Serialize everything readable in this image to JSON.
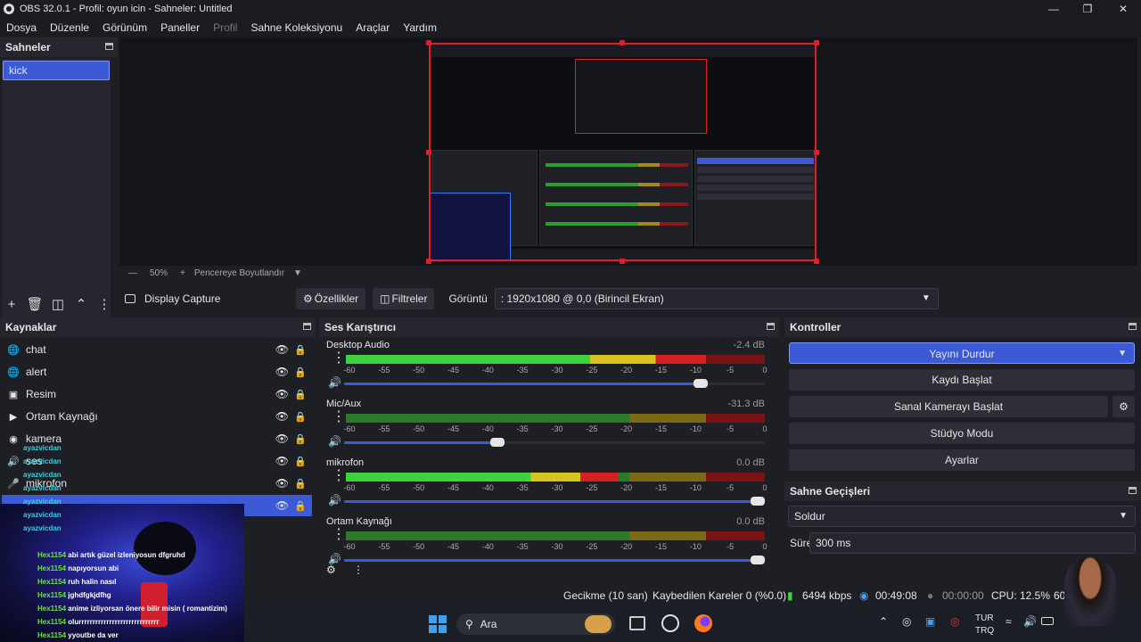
{
  "window": {
    "title": "OBS 32.0.1 - Profil: oyun icin - Sahneler: Untitled"
  },
  "menu": [
    "Dosya",
    "Düzenle",
    "Görünüm",
    "Paneller",
    "Profil",
    "Sahne Koleksiyonu",
    "Araçlar",
    "Yardım"
  ],
  "scenes": {
    "title": "Sahneler",
    "items": [
      "kick"
    ]
  },
  "preview": {
    "zoom": "50%",
    "fit_label": "Pencereye Boyutlandır"
  },
  "context": {
    "source_name": "Display Capture",
    "properties_label": "Özellikler",
    "filters_label": "Filtreler",
    "display_label": "Görüntü",
    "display_value": ": 1920x1080 @ 0,0 (Birincil Ekran)"
  },
  "sources": {
    "title": "Kaynaklar",
    "items": [
      {
        "name": "chat",
        "icon": "globe-icon"
      },
      {
        "name": "alert",
        "icon": "globe-icon"
      },
      {
        "name": "Resim",
        "icon": "image-icon"
      },
      {
        "name": "Ortam Kaynağı",
        "icon": "play-icon"
      },
      {
        "name": "kamera",
        "icon": "camera-icon"
      },
      {
        "name": "ses",
        "icon": "speaker-icon"
      },
      {
        "name": "mikrofon",
        "icon": "mic-icon"
      },
      {
        "name": "",
        "icon": "monitor-icon"
      }
    ]
  },
  "mixer": {
    "title": "Ses Karıştırıcı",
    "ticks": [
      "-60",
      "-55",
      "-50",
      "-45",
      "-40",
      "-35",
      "-30",
      "-25",
      "-20",
      "-15",
      "-10",
      "-5",
      "0"
    ],
    "channels": [
      {
        "name": "Desktop Audio",
        "db": "-2.4 dB",
        "level": 0.86,
        "volume": 0.86
      },
      {
        "name": "Mic/Aux",
        "db": "-31.3 dB",
        "level": 0.0,
        "volume": 0.36
      },
      {
        "name": "mikrofon",
        "db": "0.0 dB",
        "level": 0.65,
        "volume": 1.0
      },
      {
        "name": "Ortam Kaynağı",
        "db": "0.0 dB",
        "level": 0.0,
        "volume": 1.0
      }
    ]
  },
  "controls": {
    "title": "Kontroller",
    "stop_stream": "Yayını Durdur",
    "start_record": "Kaydı Başlat",
    "start_virtualcam": "Sanal Kamerayı Başlat",
    "studio_mode": "Stüdyo Modu",
    "settings": "Ayarlar"
  },
  "transitions": {
    "title": "Sahne Geçişleri",
    "selected": "Soldur",
    "duration_label": "Süre",
    "duration_value": "300 ms"
  },
  "status": {
    "delay": "Gecikme (10 san)",
    "dropped": "Kaybedilen Kareler 0 (%0.0)",
    "bitrate": "6494 kbps",
    "stream_time": "00:49:08",
    "record_time": "00:00:00",
    "cpu": "CPU: 12.5%",
    "fps": "60.00 FPS"
  },
  "taskbar": {
    "search_placeholder": "Ara",
    "lang": "TUR",
    "lang2": "TRQ"
  },
  "chat": {
    "user_lines": [
      "ayazvicdan",
      "ayazvicdan",
      "ayazvicdan",
      "ayazvicdan",
      "ayazvicdan",
      "ayazvicdan",
      "ayazvicdan"
    ],
    "messages": [
      {
        "user": "Hex1154",
        "text": "abi artık güzel izleniyosun dfgruhd"
      },
      {
        "user": "Hex1154",
        "text": "napıyorsun abi"
      },
      {
        "user": "Hex1154",
        "text": "ruh halin nasıl"
      },
      {
        "user": "Hex1154",
        "text": "jghdfgkjdfhg"
      },
      {
        "user": "Hex1154",
        "text": "anime izliyorsan önere bilir misin ( romantizim)"
      },
      {
        "user": "Hex1154",
        "text": "olurrrrrrrrrrrrrrrrrrrrrrrrrrrrr"
      },
      {
        "user": "Hex1154",
        "text": "yyoutbe da ver"
      }
    ]
  },
  "colors": {
    "accent": "#3c5ad6",
    "preview_border": "#e31d2a"
  }
}
